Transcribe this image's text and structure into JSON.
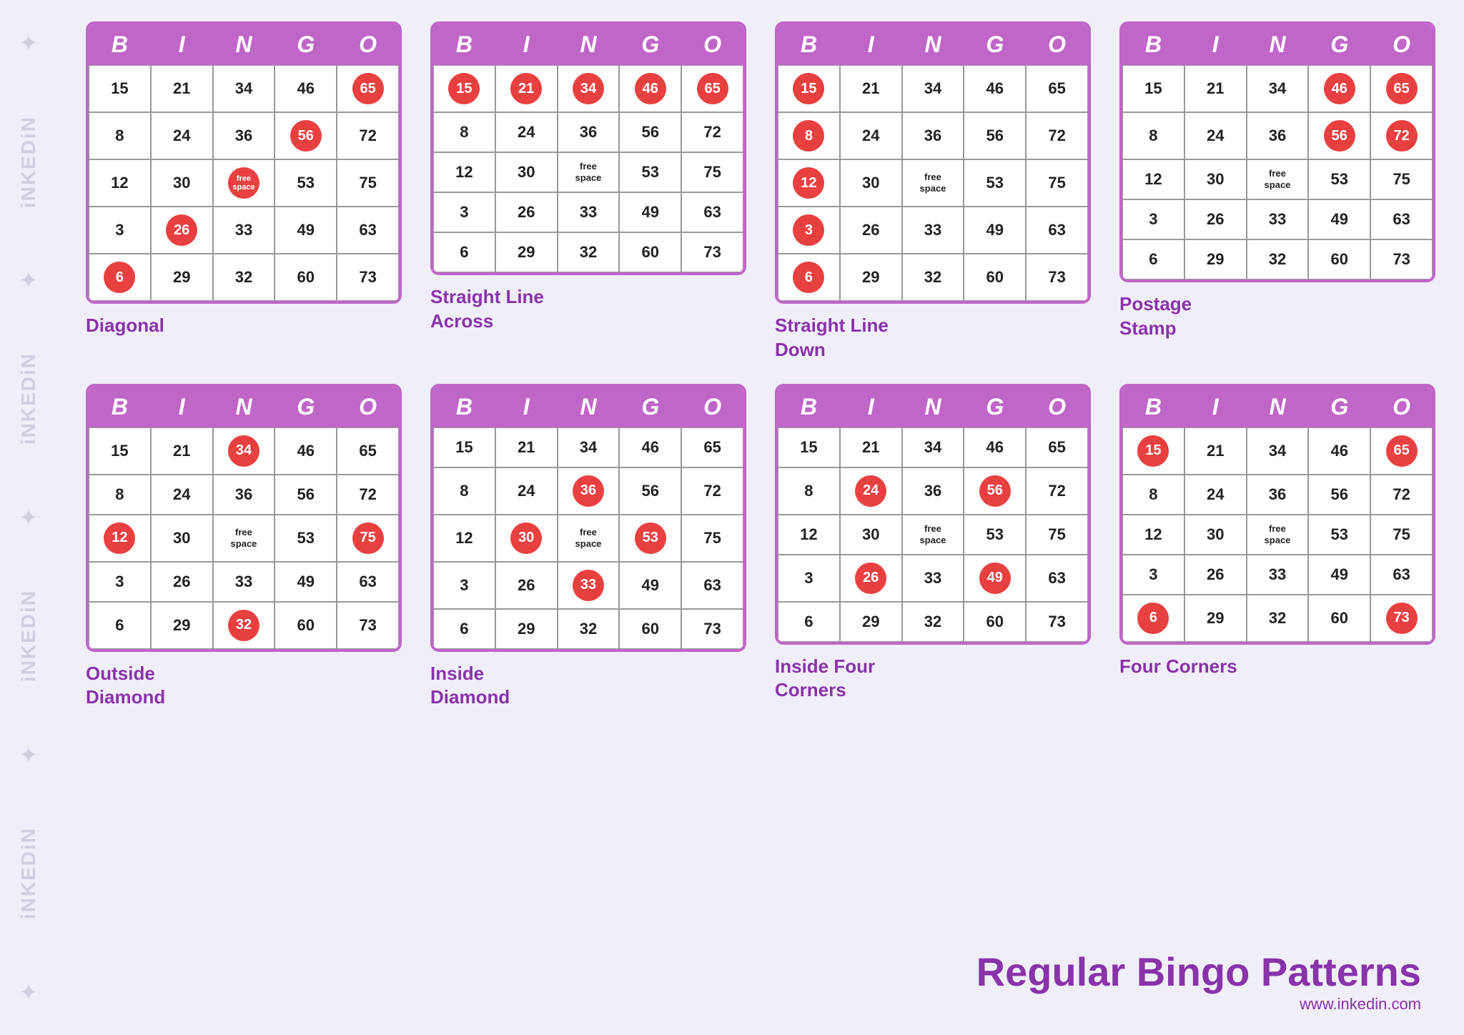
{
  "watermark": {
    "texts": [
      "✦iNKEDiN",
      "✦iNKEDiN",
      "✦iNKEDiN",
      "✦iNKEDiN"
    ]
  },
  "header_letters": [
    "B",
    "I",
    "N",
    "G",
    "O"
  ],
  "cards": [
    {
      "id": "diagonal",
      "label": "Diagonal",
      "rows": [
        [
          {
            "v": "15",
            "m": false
          },
          {
            "v": "21",
            "m": false
          },
          {
            "v": "34",
            "m": false
          },
          {
            "v": "46",
            "m": false
          },
          {
            "v": "65",
            "m": true
          }
        ],
        [
          {
            "v": "8",
            "m": false
          },
          {
            "v": "24",
            "m": false
          },
          {
            "v": "36",
            "m": false
          },
          {
            "v": "56",
            "m": true
          },
          {
            "v": "72",
            "m": false
          }
        ],
        [
          {
            "v": "12",
            "m": false
          },
          {
            "v": "30",
            "m": false
          },
          {
            "v": "free space",
            "m": true,
            "free": true
          },
          {
            "v": "53",
            "m": false
          },
          {
            "v": "75",
            "m": false
          }
        ],
        [
          {
            "v": "3",
            "m": false
          },
          {
            "v": "26",
            "m": true
          },
          {
            "v": "33",
            "m": false
          },
          {
            "v": "49",
            "m": false
          },
          {
            "v": "63",
            "m": false
          }
        ],
        [
          {
            "v": "6",
            "m": true
          },
          {
            "v": "29",
            "m": false
          },
          {
            "v": "32",
            "m": false
          },
          {
            "v": "60",
            "m": false
          },
          {
            "v": "73",
            "m": false
          }
        ]
      ]
    },
    {
      "id": "straight-line-across",
      "label": "Straight Line\nAcross",
      "rows": [
        [
          {
            "v": "15",
            "m": true
          },
          {
            "v": "21",
            "m": true
          },
          {
            "v": "34",
            "m": true
          },
          {
            "v": "46",
            "m": true
          },
          {
            "v": "65",
            "m": true
          }
        ],
        [
          {
            "v": "8",
            "m": false
          },
          {
            "v": "24",
            "m": false
          },
          {
            "v": "36",
            "m": false
          },
          {
            "v": "56",
            "m": false
          },
          {
            "v": "72",
            "m": false
          }
        ],
        [
          {
            "v": "12",
            "m": false
          },
          {
            "v": "30",
            "m": false
          },
          {
            "v": "free space",
            "m": false,
            "free": true
          },
          {
            "v": "53",
            "m": false
          },
          {
            "v": "75",
            "m": false
          }
        ],
        [
          {
            "v": "3",
            "m": false
          },
          {
            "v": "26",
            "m": false
          },
          {
            "v": "33",
            "m": false
          },
          {
            "v": "49",
            "m": false
          },
          {
            "v": "63",
            "m": false
          }
        ],
        [
          {
            "v": "6",
            "m": false
          },
          {
            "v": "29",
            "m": false
          },
          {
            "v": "32",
            "m": false
          },
          {
            "v": "60",
            "m": false
          },
          {
            "v": "73",
            "m": false
          }
        ]
      ]
    },
    {
      "id": "straight-line-down",
      "label": "Straight Line\nDown",
      "rows": [
        [
          {
            "v": "15",
            "m": true
          },
          {
            "v": "21",
            "m": false
          },
          {
            "v": "34",
            "m": false
          },
          {
            "v": "46",
            "m": false
          },
          {
            "v": "65",
            "m": false
          }
        ],
        [
          {
            "v": "8",
            "m": true
          },
          {
            "v": "24",
            "m": false
          },
          {
            "v": "36",
            "m": false
          },
          {
            "v": "56",
            "m": false
          },
          {
            "v": "72",
            "m": false
          }
        ],
        [
          {
            "v": "12",
            "m": true
          },
          {
            "v": "30",
            "m": false
          },
          {
            "v": "free space",
            "m": false,
            "free": true
          },
          {
            "v": "53",
            "m": false
          },
          {
            "v": "75",
            "m": false
          }
        ],
        [
          {
            "v": "3",
            "m": true
          },
          {
            "v": "26",
            "m": false
          },
          {
            "v": "33",
            "m": false
          },
          {
            "v": "49",
            "m": false
          },
          {
            "v": "63",
            "m": false
          }
        ],
        [
          {
            "v": "6",
            "m": true
          },
          {
            "v": "29",
            "m": false
          },
          {
            "v": "32",
            "m": false
          },
          {
            "v": "60",
            "m": false
          },
          {
            "v": "73",
            "m": false
          }
        ]
      ]
    },
    {
      "id": "postage-stamp",
      "label": "Postage\nStamp",
      "rows": [
        [
          {
            "v": "15",
            "m": false
          },
          {
            "v": "21",
            "m": false
          },
          {
            "v": "34",
            "m": false
          },
          {
            "v": "46",
            "m": true
          },
          {
            "v": "65",
            "m": true
          }
        ],
        [
          {
            "v": "8",
            "m": false
          },
          {
            "v": "24",
            "m": false
          },
          {
            "v": "36",
            "m": false
          },
          {
            "v": "56",
            "m": true
          },
          {
            "v": "72",
            "m": true
          }
        ],
        [
          {
            "v": "12",
            "m": false
          },
          {
            "v": "30",
            "m": false
          },
          {
            "v": "free space",
            "m": false,
            "free": true
          },
          {
            "v": "53",
            "m": false
          },
          {
            "v": "75",
            "m": false
          }
        ],
        [
          {
            "v": "3",
            "m": false
          },
          {
            "v": "26",
            "m": false
          },
          {
            "v": "33",
            "m": false
          },
          {
            "v": "49",
            "m": false
          },
          {
            "v": "63",
            "m": false
          }
        ],
        [
          {
            "v": "6",
            "m": false
          },
          {
            "v": "29",
            "m": false
          },
          {
            "v": "32",
            "m": false
          },
          {
            "v": "60",
            "m": false
          },
          {
            "v": "73",
            "m": false
          }
        ]
      ]
    },
    {
      "id": "outside-diamond",
      "label": "Outside\nDiamond",
      "rows": [
        [
          {
            "v": "15",
            "m": false
          },
          {
            "v": "21",
            "m": false
          },
          {
            "v": "34",
            "m": true
          },
          {
            "v": "46",
            "m": false
          },
          {
            "v": "65",
            "m": false
          }
        ],
        [
          {
            "v": "8",
            "m": false
          },
          {
            "v": "24",
            "m": false
          },
          {
            "v": "36",
            "m": false
          },
          {
            "v": "56",
            "m": false
          },
          {
            "v": "72",
            "m": false
          }
        ],
        [
          {
            "v": "12",
            "m": true
          },
          {
            "v": "30",
            "m": false
          },
          {
            "v": "free space",
            "m": false,
            "free": true
          },
          {
            "v": "53",
            "m": false
          },
          {
            "v": "75",
            "m": true
          }
        ],
        [
          {
            "v": "3",
            "m": false
          },
          {
            "v": "26",
            "m": false
          },
          {
            "v": "33",
            "m": false
          },
          {
            "v": "49",
            "m": false
          },
          {
            "v": "63",
            "m": false
          }
        ],
        [
          {
            "v": "6",
            "m": false
          },
          {
            "v": "29",
            "m": false
          },
          {
            "v": "32",
            "m": true
          },
          {
            "v": "60",
            "m": false
          },
          {
            "v": "73",
            "m": false
          }
        ]
      ]
    },
    {
      "id": "inside-diamond",
      "label": "Inside\nDiamond",
      "rows": [
        [
          {
            "v": "15",
            "m": false
          },
          {
            "v": "21",
            "m": false
          },
          {
            "v": "34",
            "m": false
          },
          {
            "v": "46",
            "m": false
          },
          {
            "v": "65",
            "m": false
          }
        ],
        [
          {
            "v": "8",
            "m": false
          },
          {
            "v": "24",
            "m": false
          },
          {
            "v": "36",
            "m": true
          },
          {
            "v": "56",
            "m": false
          },
          {
            "v": "72",
            "m": false
          }
        ],
        [
          {
            "v": "12",
            "m": false
          },
          {
            "v": "30",
            "m": true
          },
          {
            "v": "free space",
            "m": false,
            "free": true
          },
          {
            "v": "53",
            "m": true
          },
          {
            "v": "75",
            "m": false
          }
        ],
        [
          {
            "v": "3",
            "m": false
          },
          {
            "v": "26",
            "m": false
          },
          {
            "v": "33",
            "m": true
          },
          {
            "v": "49",
            "m": false
          },
          {
            "v": "63",
            "m": false
          }
        ],
        [
          {
            "v": "6",
            "m": false
          },
          {
            "v": "29",
            "m": false
          },
          {
            "v": "32",
            "m": false
          },
          {
            "v": "60",
            "m": false
          },
          {
            "v": "73",
            "m": false
          }
        ]
      ]
    },
    {
      "id": "inside-four-corners",
      "label": "Inside Four\nCorners",
      "rows": [
        [
          {
            "v": "15",
            "m": false
          },
          {
            "v": "21",
            "m": false
          },
          {
            "v": "34",
            "m": false
          },
          {
            "v": "46",
            "m": false
          },
          {
            "v": "65",
            "m": false
          }
        ],
        [
          {
            "v": "8",
            "m": false
          },
          {
            "v": "24",
            "m": true
          },
          {
            "v": "36",
            "m": false
          },
          {
            "v": "56",
            "m": true
          },
          {
            "v": "72",
            "m": false
          }
        ],
        [
          {
            "v": "12",
            "m": false
          },
          {
            "v": "30",
            "m": false
          },
          {
            "v": "free space",
            "m": false,
            "free": true
          },
          {
            "v": "53",
            "m": false
          },
          {
            "v": "75",
            "m": false
          }
        ],
        [
          {
            "v": "3",
            "m": false
          },
          {
            "v": "26",
            "m": true
          },
          {
            "v": "33",
            "m": false
          },
          {
            "v": "49",
            "m": true
          },
          {
            "v": "63",
            "m": false
          }
        ],
        [
          {
            "v": "6",
            "m": false
          },
          {
            "v": "29",
            "m": false
          },
          {
            "v": "32",
            "m": false
          },
          {
            "v": "60",
            "m": false
          },
          {
            "v": "73",
            "m": false
          }
        ]
      ]
    },
    {
      "id": "four-corners",
      "label": "Four Corners",
      "rows": [
        [
          {
            "v": "15",
            "m": true
          },
          {
            "v": "21",
            "m": false
          },
          {
            "v": "34",
            "m": false
          },
          {
            "v": "46",
            "m": false
          },
          {
            "v": "65",
            "m": true
          }
        ],
        [
          {
            "v": "8",
            "m": false
          },
          {
            "v": "24",
            "m": false
          },
          {
            "v": "36",
            "m": false
          },
          {
            "v": "56",
            "m": false
          },
          {
            "v": "72",
            "m": false
          }
        ],
        [
          {
            "v": "12",
            "m": false
          },
          {
            "v": "30",
            "m": false
          },
          {
            "v": "free space",
            "m": false,
            "free": true
          },
          {
            "v": "53",
            "m": false
          },
          {
            "v": "75",
            "m": false
          }
        ],
        [
          {
            "v": "3",
            "m": false
          },
          {
            "v": "26",
            "m": false
          },
          {
            "v": "33",
            "m": false
          },
          {
            "v": "49",
            "m": false
          },
          {
            "v": "63",
            "m": false
          }
        ],
        [
          {
            "v": "6",
            "m": true
          },
          {
            "v": "29",
            "m": false
          },
          {
            "v": "32",
            "m": false
          },
          {
            "v": "60",
            "m": false
          },
          {
            "v": "73",
            "m": true
          }
        ]
      ]
    }
  ],
  "footer": {
    "title": "Regular Bingo Patterns",
    "url": "www.inkedin.com"
  }
}
